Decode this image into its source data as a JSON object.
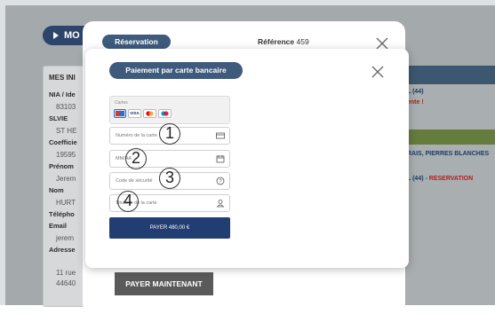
{
  "background": {
    "top_button": "MO",
    "left_panel": {
      "title": "MES INI",
      "rows": [
        {
          "label": "NIA / Ide",
          "value": "83103"
        },
        {
          "label": "SLVIE",
          "value": "ST HE"
        },
        {
          "label": "Coefficie",
          "value": "19595"
        },
        {
          "label": "Prénom",
          "value": "Jerem"
        },
        {
          "label": "Nom",
          "value": "HURT"
        },
        {
          "label": "Télépho",
          "value": ""
        },
        {
          "label": "Email",
          "value": "jerem"
        },
        {
          "label": "Adresse",
          "value": ""
        }
      ],
      "address_lines": [
        "11 rue",
        "44640"
      ]
    },
    "right_strip": {
      "line1": "L (44)",
      "line2": "ente !",
      "line3": "RAIS, PIERRES BLANCHES",
      "line4_blue": "L (44) - ",
      "line4_red": "RESERVATION"
    }
  },
  "reservation_modal": {
    "title": "Réservation",
    "reference_label": "Référence",
    "reference_value": "459",
    "pay_now": "PAYER MAINTENANT"
  },
  "card_modal": {
    "title": "Paiement par carte bancaire",
    "cards_label": "Cartes",
    "card_brands": [
      "cb",
      "visa",
      "mastercard",
      "maestro"
    ],
    "fields": [
      {
        "placeholder": "Numéro de la carte",
        "icon": "card-icon"
      },
      {
        "placeholder": "MM/AA",
        "icon": "calendar-icon"
      },
      {
        "placeholder": "Code de sécurité",
        "icon": "help-icon"
      },
      {
        "placeholder": "Titulaire de la carte",
        "icon": "person-icon"
      }
    ],
    "pay_button": "PAYER 480,00 €"
  },
  "callouts": [
    "1",
    "2",
    "3",
    "4"
  ],
  "colors": {
    "navy": "#213d72",
    "pill": "#3e5a7c",
    "accent_red": "#b0201d",
    "green": "#657c3e"
  }
}
